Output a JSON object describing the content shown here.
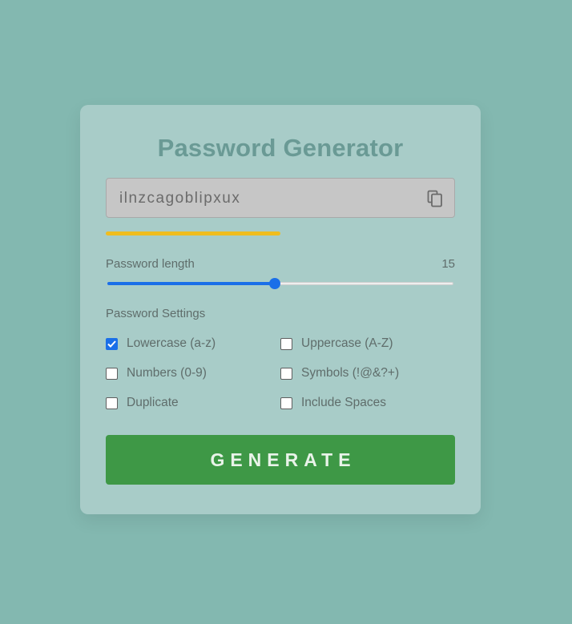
{
  "app": {
    "title": "Password Generator"
  },
  "password": {
    "value": "ilnzcagoblipxux",
    "copy_icon": "copy-icon",
    "strength_fraction": 0.5,
    "strength_color": "#f0bd1e"
  },
  "length": {
    "label": "Password length",
    "value": "15",
    "min": 1,
    "max": 30
  },
  "settings": {
    "label": "Password Settings",
    "options": [
      {
        "label": "Lowercase (a-z)",
        "checked": true
      },
      {
        "label": "Uppercase (A-Z)",
        "checked": false
      },
      {
        "label": "Numbers (0-9)",
        "checked": false
      },
      {
        "label": "Symbols (!@&?+)",
        "checked": false
      },
      {
        "label": "Duplicate",
        "checked": false
      },
      {
        "label": "Include Spaces",
        "checked": false
      }
    ]
  },
  "generate_button": {
    "label": "GENERATE"
  },
  "colors": {
    "background": "#83b8b0",
    "card": "#a8ccc8",
    "title": "#6a9a95",
    "accent_blue": "#1a6fe8",
    "button_green": "#3e9846"
  }
}
